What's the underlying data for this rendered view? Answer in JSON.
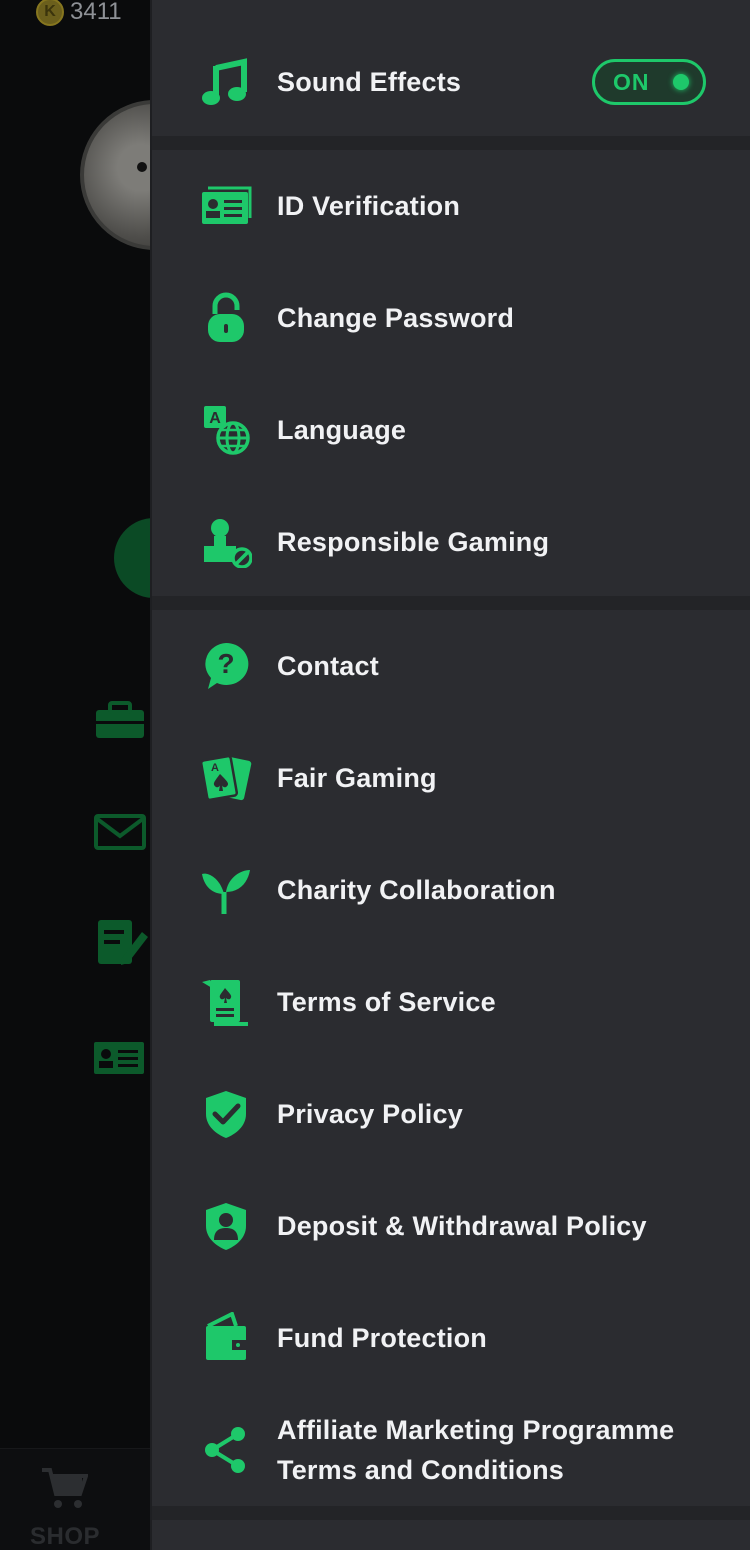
{
  "background": {
    "coin_balance": "3411",
    "coin_symbol": "K",
    "shop_label": "SHOP"
  },
  "colors": {
    "accent": "#1ec86a",
    "panel_bg": "#2b2c30",
    "divider": "#232427",
    "text": "#f1f2f4"
  },
  "settings": {
    "sound_effects": {
      "label": "Sound Effects",
      "toggle_text": "ON",
      "state": "on",
      "icon": "music-note-icon"
    },
    "account_items": [
      {
        "label": "ID Verification",
        "icon": "id-card-icon"
      },
      {
        "label": "Change Password",
        "icon": "lock-icon"
      },
      {
        "label": "Language",
        "icon": "language-globe-icon"
      },
      {
        "label": "Responsible Gaming",
        "icon": "user-block-icon"
      }
    ],
    "info_items": [
      {
        "label": "Contact",
        "icon": "help-bubble-icon"
      },
      {
        "label": "Fair Gaming",
        "icon": "playing-cards-icon"
      },
      {
        "label": "Charity Collaboration",
        "icon": "sprout-icon"
      },
      {
        "label": "Terms of Service",
        "icon": "document-icon"
      },
      {
        "label": "Privacy Policy",
        "icon": "shield-check-icon"
      },
      {
        "label": "Deposit & Withdrawal Policy",
        "icon": "shield-user-icon"
      },
      {
        "label": "Fund Protection",
        "icon": "wallet-icon"
      },
      {
        "label": "Affiliate Marketing Programme Terms and Conditions",
        "label_line1": "Affiliate Marketing Programme",
        "label_line2": "Terms and Conditions",
        "icon": "share-icon"
      }
    ]
  }
}
